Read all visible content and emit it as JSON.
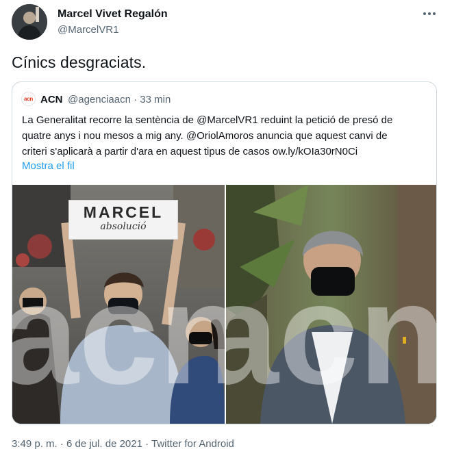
{
  "author": {
    "name": "Marcel Vivet Regalón",
    "handle": "@MarcelVR1"
  },
  "tweet": {
    "text": "Cínics desgraciats."
  },
  "quoted": {
    "avatar_text": "acn",
    "name": "ACN",
    "handle": "@agenciaacn · 33 min",
    "lines": [
      "La Generalitat recorre la sentència de @MarcelVR1 reduint la petició de presó de",
      "quatre anys i nou mesos a mig any. @OriolAmoros anuncia que aquest canvi de",
      "criteri s'aplicarà a partir d'ara en aquest tipus de casos ow.ly/kOIa30rN0Ci"
    ],
    "show_thread": "Mostra el fil",
    "photo_left": {
      "sign_title": "MARCEL",
      "sign_subtitle": "absolució"
    },
    "watermark": "acn"
  },
  "footer": {
    "timestamp": "3:49 p. m. · 6 de jul. de 2021 · Twitter for Android"
  },
  "icons": {
    "more": "more-horizontal-icon"
  },
  "colors": {
    "link": "#1d9bf0",
    "secondary": "#536471",
    "border": "#cfd9de"
  }
}
